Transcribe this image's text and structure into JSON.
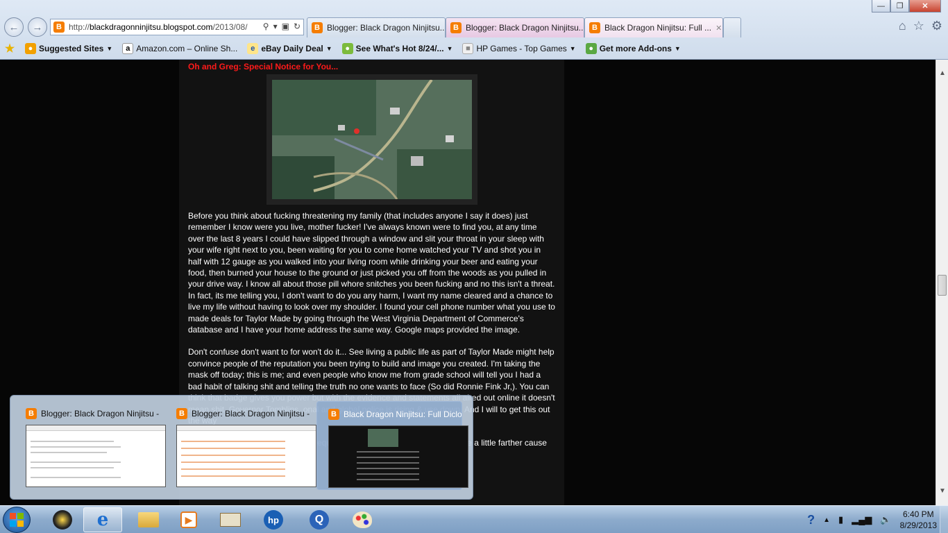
{
  "browser": {
    "address": {
      "url_prefix": "http://",
      "url_domain": "blackdragonninjitsu.blogspot.com",
      "url_path": "/2013/08/"
    },
    "tabs": [
      {
        "label": "Blogger: Black Dragon Ninjitsu..."
      },
      {
        "label": "Blogger: Black Dragon Ninjitsu..."
      },
      {
        "label": "Black Dragon Ninjitsu: Full ..."
      }
    ],
    "favorites": [
      {
        "label": "Suggested Sites"
      },
      {
        "label": "Amazon.com – Online Sh..."
      },
      {
        "label": "eBay Daily Deal"
      },
      {
        "label": "See What's Hot 8/24/..."
      },
      {
        "label": "HP Games - Top Games"
      },
      {
        "label": "Get more Add-ons"
      }
    ]
  },
  "page": {
    "notice": "Oh and Greg: Special Notice for You...",
    "paragraphs": [
      "Before you think about fucking threatening my family (that includes anyone I say it does) just remember I know were you live, mother fucker! I've always known were to find you, at any time over the last 8 years I could have slipped through a window and slit your throat in your sleep with your wife right next to you, been waiting for you to come home watched your TV and shot you in half with 12 gauge as you walked into your living room while drinking your beer and eating your food, then burned your house to the ground or just picked you off from the woods as you pulled in your drive way. I know all about those pill whore snitches you been fucking and no this isn't a threat. In fact, its me telling you, I don't want to do you any harm, I want my name cleared and a chance to live my life without having to look over my shoulder. I found your cell phone number what you use to made deals for Taylor Made by going through the West Virginia Department of Commerce's database and I have your home address the same way. Google maps provided the image.",
      "Don't confuse don't want to for won't do it... See living a public life as part of Taylor Made might help convince people of the reputation you been trying to build and image you created. I'm taking the mask off today; this is me; and even people who know me from grade school will tell you I had a bad habit of talking shit and telling the truth no one wants to face (So did Ronnie Fink Jr,). You can think that badge gives you power but with the evidence and statements all aired out online it doesn't mean shit. Governor Tomblins. onal and global police is rising & use down. And I will to get this out the way",
      "t how you set me up (take the consequences like a man) or you can push me a little farther cause I'm willing to test the"
    ]
  },
  "preview": {
    "windows": [
      {
        "title": "Blogger: Black Dragon Ninjitsu -..."
      },
      {
        "title": "Blogger: Black Dragon Ninjitsu -..."
      },
      {
        "title": "Black Dragon Ninjitsu: Full Diclo..."
      }
    ]
  },
  "taskbar": {
    "items": [
      {
        "icon": "media-center-icon"
      },
      {
        "icon": "internet-explorer-icon"
      },
      {
        "icon": "file-explorer-icon"
      },
      {
        "icon": "media-player-icon"
      },
      {
        "icon": "presentation-icon"
      },
      {
        "icon": "hp-icon"
      },
      {
        "icon": "quicktime-icon"
      },
      {
        "icon": "paint-icon"
      }
    ],
    "clock": {
      "time": "6:40 PM",
      "date": "8/29/2013"
    }
  },
  "colors": {
    "notice": "#ff1a1a",
    "page_bg": "#060606",
    "content_bg": "#121212",
    "blogger_orange": "#f57d00"
  }
}
